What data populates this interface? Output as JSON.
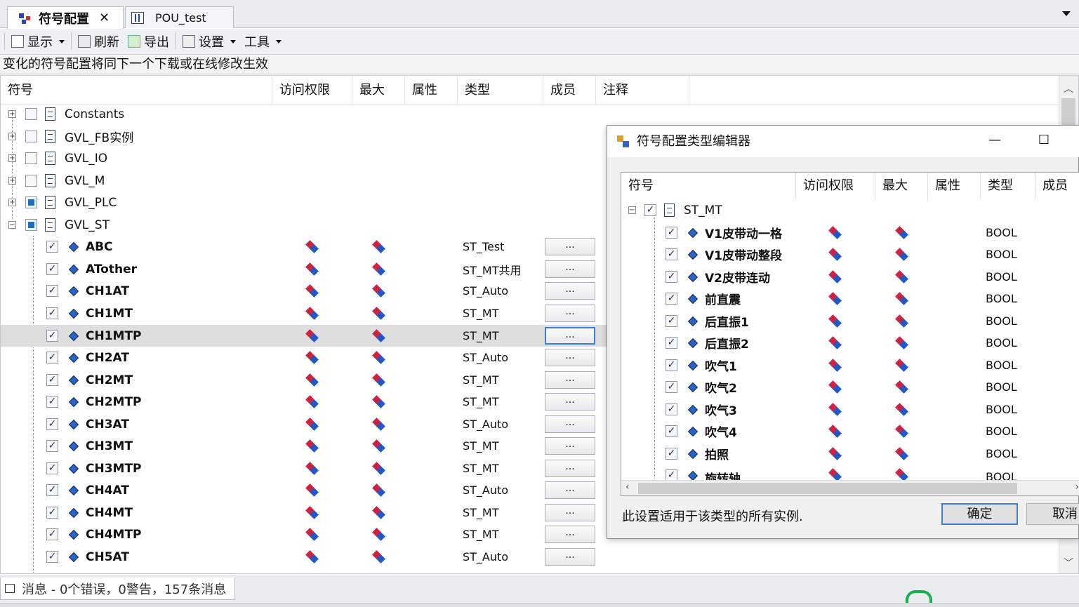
{
  "tabs": [
    {
      "label": "符号配置",
      "close": "✕"
    },
    {
      "label": "POU_test"
    }
  ],
  "toolbar": {
    "display": "显示",
    "refresh": "刷新",
    "export": "导出",
    "settings": "设置",
    "tools": "工具"
  },
  "info_text": "变化的符号配置将同下一个下载或在线修改生效",
  "columns": {
    "symbol": "符号",
    "access": "访问权限",
    "max": "最大",
    "attr": "属性",
    "type": "类型",
    "members": "成员",
    "comment": "注释"
  },
  "groups": [
    {
      "name": "Constants",
      "state": "unchecked",
      "expand": "+"
    },
    {
      "name": "GVL_FB实例",
      "state": "unchecked",
      "expand": "+"
    },
    {
      "name": "GVL_IO",
      "state": "unchecked",
      "expand": "+"
    },
    {
      "name": "GVL_M",
      "state": "unchecked",
      "expand": "+"
    },
    {
      "name": "GVL_PLC",
      "state": "partial",
      "expand": "+"
    },
    {
      "name": "GVL_ST",
      "state": "partial",
      "expand": "−"
    }
  ],
  "vars": [
    {
      "name": "ABC",
      "type": "ST_Test",
      "btn": "..."
    },
    {
      "name": "ATother",
      "type": "ST_MT共用",
      "btn": "..."
    },
    {
      "name": "CH1AT",
      "type": "ST_Auto",
      "btn": "..."
    },
    {
      "name": "CH1MT",
      "type": "ST_MT",
      "btn": "..."
    },
    {
      "name": "CH1MTP",
      "type": "ST_MT",
      "btn": "...",
      "selected": true
    },
    {
      "name": "CH2AT",
      "type": "ST_Auto",
      "btn": "..."
    },
    {
      "name": "CH2MT",
      "type": "ST_MT",
      "btn": "..."
    },
    {
      "name": "CH2MTP",
      "type": "ST_MT",
      "btn": "..."
    },
    {
      "name": "CH3AT",
      "type": "ST_Auto",
      "btn": "..."
    },
    {
      "name": "CH3MT",
      "type": "ST_MT",
      "btn": "..."
    },
    {
      "name": "CH3MTP",
      "type": "ST_MT",
      "btn": "..."
    },
    {
      "name": "CH4AT",
      "type": "ST_Auto",
      "btn": "..."
    },
    {
      "name": "CH4MT",
      "type": "ST_MT",
      "btn": "..."
    },
    {
      "name": "CH4MTP",
      "type": "ST_MT",
      "btn": "..."
    },
    {
      "name": "CH5AT",
      "type": "ST_Auto",
      "btn": "..."
    }
  ],
  "dialog": {
    "title": "符号配置类型编辑器",
    "min": "—",
    "max": "☐",
    "columns": {
      "symbol": "符号",
      "access": "访问权限",
      "max": "最大",
      "attr": "属性",
      "type": "类型",
      "members": "成员"
    },
    "root": "ST_MT",
    "members": [
      {
        "name": "V1皮带动一格",
        "type": "BOOL"
      },
      {
        "name": "V1皮带动整段",
        "type": "BOOL"
      },
      {
        "name": "V2皮带连动",
        "type": "BOOL"
      },
      {
        "name": "前直震",
        "type": "BOOL"
      },
      {
        "name": "后直振1",
        "type": "BOOL"
      },
      {
        "name": "后直振2",
        "type": "BOOL"
      },
      {
        "name": "吹气1",
        "type": "BOOL"
      },
      {
        "name": "吹气2",
        "type": "BOOL"
      },
      {
        "name": "吹气3",
        "type": "BOOL"
      },
      {
        "name": "吹气4",
        "type": "BOOL"
      },
      {
        "name": "拍照",
        "type": "BOOL"
      },
      {
        "name": "旋转轴",
        "type": "BOOL"
      }
    ],
    "note": "此设置适用于该类型的所有实例.",
    "ok": "确定",
    "cancel": "取消"
  },
  "messages": "消息 - 0个错误，0警告，157条消息",
  "colors": {
    "accent": "#3c7fd6",
    "selected_row": "#dedede",
    "checkbox_partial": "#1e6fbf"
  }
}
